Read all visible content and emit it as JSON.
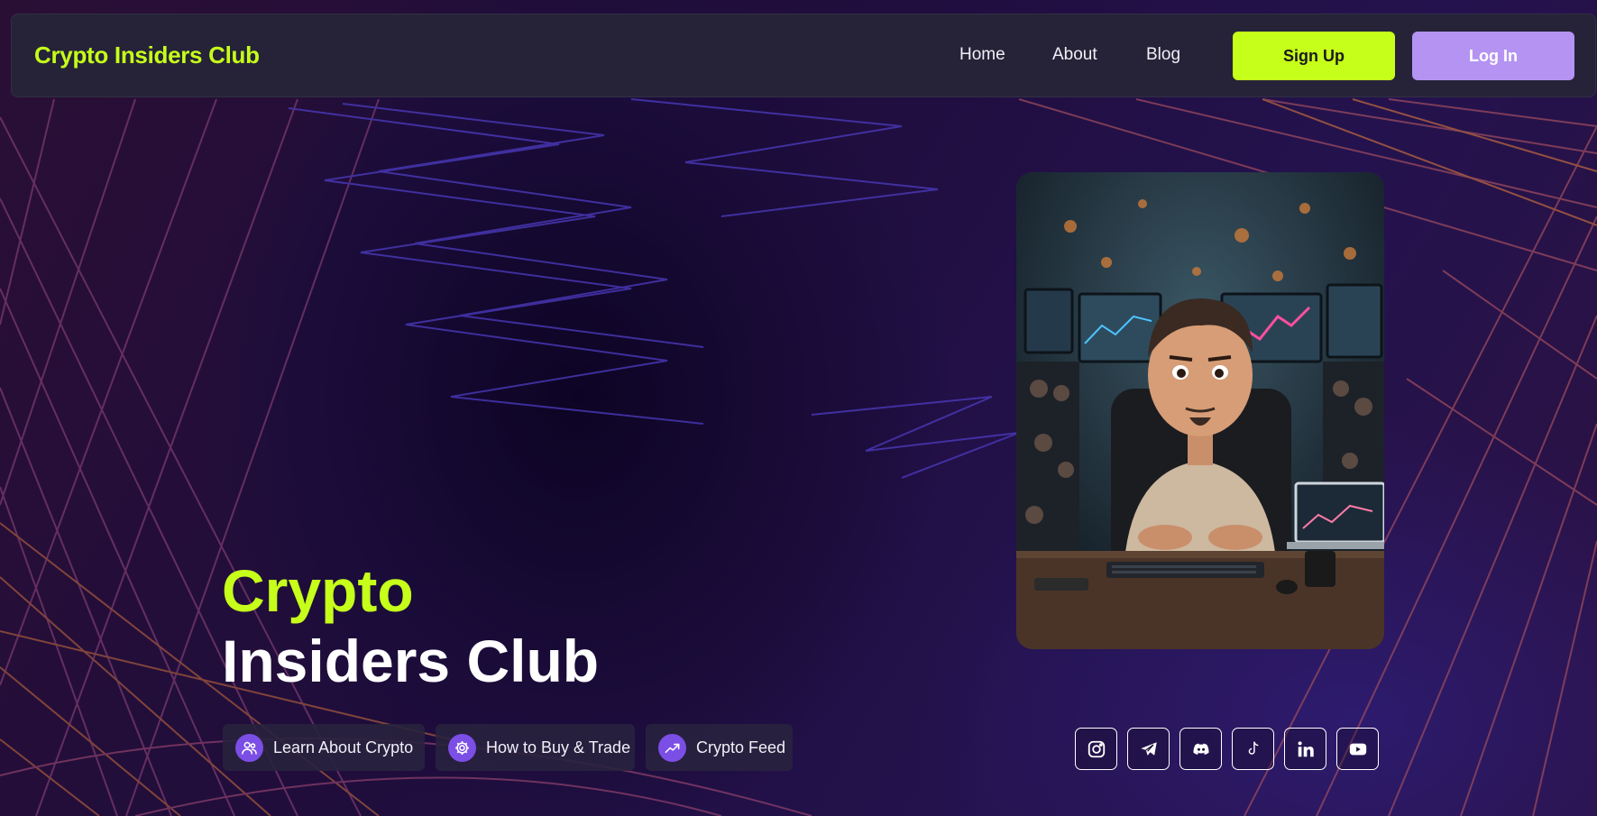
{
  "navbar": {
    "brand": "Crypto Insiders Club",
    "links": [
      {
        "label": "Home"
      },
      {
        "label": "About"
      },
      {
        "label": "Blog"
      }
    ],
    "signup_label": "Sign Up",
    "login_label": "Log In"
  },
  "hero": {
    "title_line1": "Crypto",
    "title_line2": "Insiders Club",
    "image_icon": "trader-avatar-illustration",
    "pills": [
      {
        "label": "Learn About Crypto",
        "icon": "users-icon"
      },
      {
        "label": "How to Buy & Trade",
        "icon": "gear-icon"
      },
      {
        "label": "Crypto Feed",
        "icon": "trending-up-icon"
      }
    ]
  },
  "social": [
    {
      "icon": "instagram-icon"
    },
    {
      "icon": "telegram-icon"
    },
    {
      "icon": "discord-icon"
    },
    {
      "icon": "tiktok-icon"
    },
    {
      "icon": "linkedin-icon"
    },
    {
      "icon": "youtube-icon"
    }
  ],
  "colors": {
    "accent": "#c6ff1a",
    "login_button": "#b493f2",
    "pill_icon": "#7b4ee6",
    "navbar": "#262438",
    "background": "#170a2e"
  }
}
